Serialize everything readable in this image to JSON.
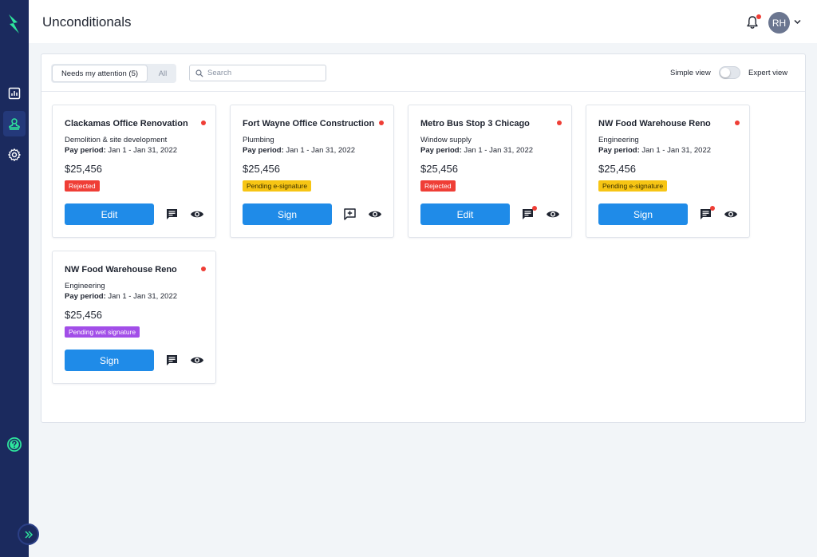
{
  "header": {
    "title": "Unconditionals",
    "avatar_initials": "RH",
    "notification_dot_color": "#ef3e36"
  },
  "sidebar": {
    "items": [
      {
        "icon": "bar-chart-icon",
        "active": false
      },
      {
        "icon": "user-stamp-icon",
        "active": true
      },
      {
        "icon": "gear-icon",
        "active": false
      }
    ],
    "help_icon": "help-circle-icon",
    "expand_icon": "double-chevron-right-icon",
    "accent": "#2ee59d",
    "background": "#1b2a5e"
  },
  "toolbar": {
    "filter_active": "Needs my attention (5)",
    "filter_all": "All",
    "search_placeholder": "Search",
    "search_value": "",
    "simple_view_label": "Simple view",
    "expert_view_label": "Expert view",
    "expert_view_on": false
  },
  "colors": {
    "primary_button": "#1f8be8",
    "rejected": "#ef3e36",
    "pending_esignature": "#f7c514",
    "pending_wet_signature": "#a24ee8"
  },
  "cards": [
    {
      "title": "Clackamas Office Renovation",
      "trade": "Demolition & site development",
      "period_label": "Pay period:",
      "period_value": "Jan 1 - Jan 31, 2022",
      "amount": "$25,456",
      "status": "Rejected",
      "status_type": "rejected",
      "action": "Edit",
      "message_icon": "message-icon",
      "message_unread": false
    },
    {
      "title": "Fort Wayne Office Construction",
      "trade": "Plumbing",
      "period_label": "Pay period:",
      "period_value": "Jan 1 - Jan 31, 2022",
      "amount": "$25,456",
      "status": "Pending e-signature",
      "status_type": "esig",
      "action": "Sign",
      "message_icon": "add-message-icon",
      "message_unread": false
    },
    {
      "title": "Metro Bus Stop 3 Chicago",
      "trade": "Window supply",
      "period_label": "Pay period:",
      "period_value": "Jan 1 - Jan 31, 2022",
      "amount": "$25,456",
      "status": "Rejected",
      "status_type": "rejected",
      "action": "Edit",
      "message_icon": "message-icon",
      "message_unread": true
    },
    {
      "title": "NW Food Warehouse Reno",
      "trade": "Engineering",
      "period_label": "Pay period:",
      "period_value": "Jan 1 - Jan 31, 2022",
      "amount": "$25,456",
      "status": "Pending e-signature",
      "status_type": "esig",
      "action": "Sign",
      "message_icon": "message-icon",
      "message_unread": true
    },
    {
      "title": "NW Food Warehouse Reno",
      "trade": "Engineering",
      "period_label": "Pay period:",
      "period_value": "Jan 1 - Jan 31, 2022",
      "amount": "$25,456",
      "status": "Pending wet signature",
      "status_type": "wet",
      "action": "Sign",
      "message_icon": "message-icon",
      "message_unread": false
    }
  ]
}
